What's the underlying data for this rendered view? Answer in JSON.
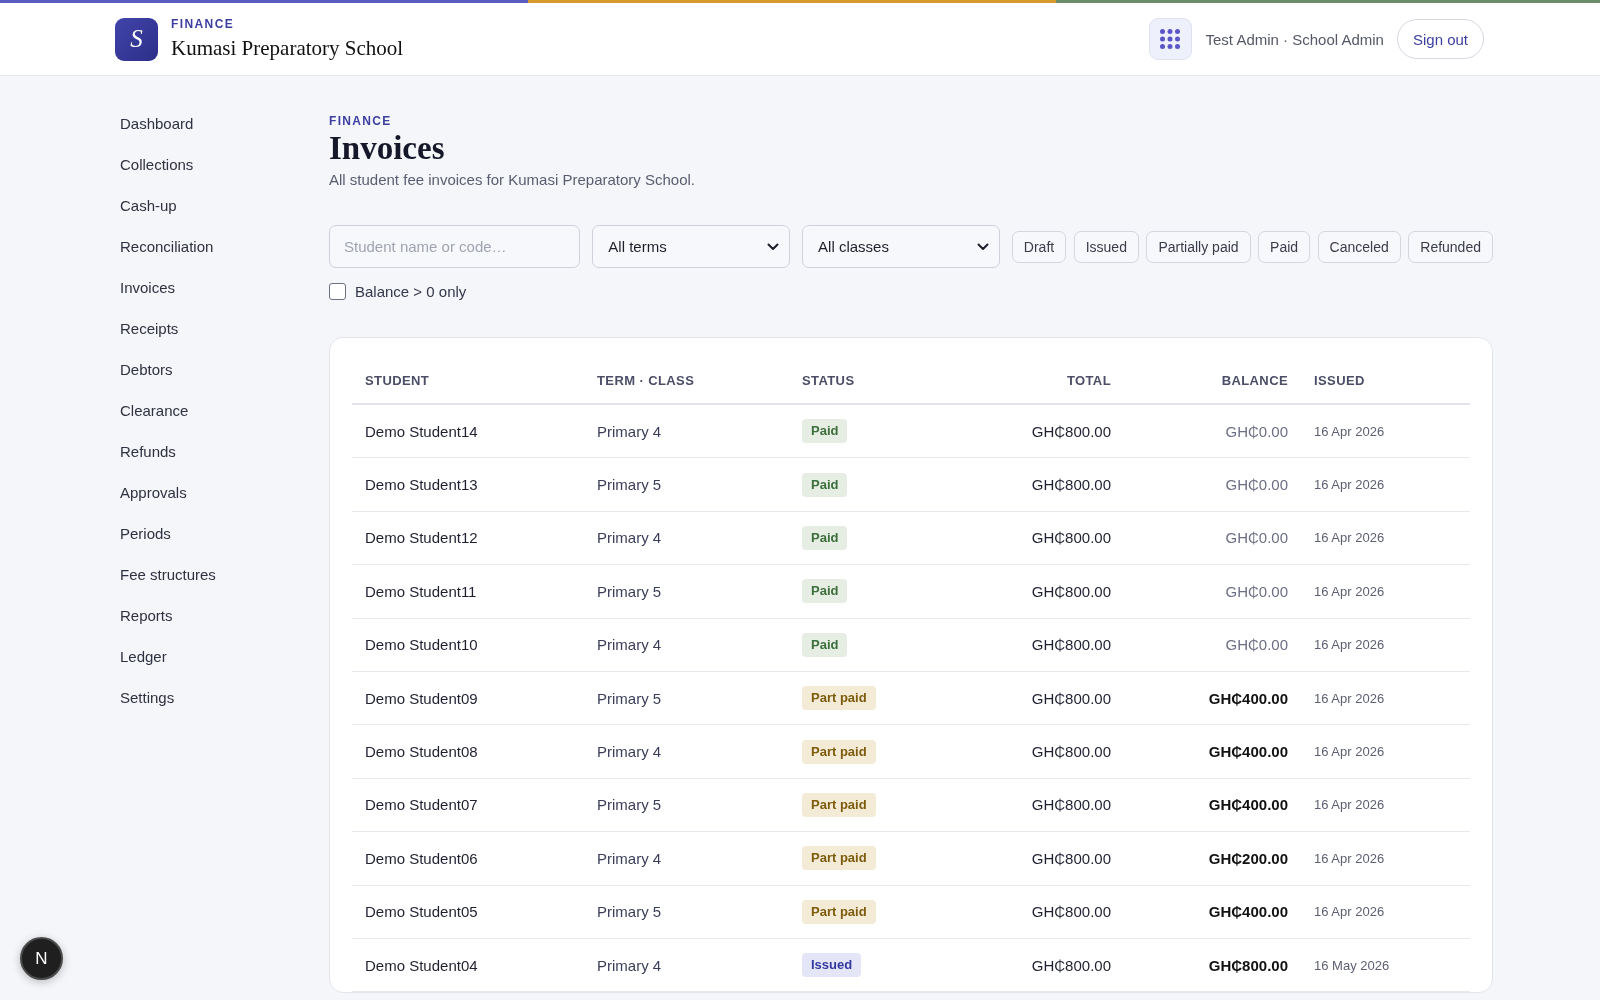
{
  "brand": {
    "logo_letter": "S",
    "section": "FINANCE",
    "school": "Kumasi Preparatory School"
  },
  "account": {
    "user": "Test Admin · School Admin",
    "sign_out": "Sign out"
  },
  "sidebar": {
    "items": [
      "Dashboard",
      "Collections",
      "Cash-up",
      "Reconciliation",
      "Invoices",
      "Receipts",
      "Debtors",
      "Clearance",
      "Refunds",
      "Approvals",
      "Periods",
      "Fee structures",
      "Reports",
      "Ledger",
      "Settings"
    ]
  },
  "page": {
    "eyebrow": "FINANCE",
    "title": "Invoices",
    "subtitle": "All student fee invoices for Kumasi Preparatory School."
  },
  "filters": {
    "search": {
      "placeholder": "Student name or code…"
    },
    "term": {
      "value": "All terms"
    },
    "class": {
      "value": "All classes"
    },
    "statuses": [
      "Draft",
      "Issued",
      "Partially paid",
      "Paid",
      "Canceled",
      "Refunded"
    ],
    "balance_only": {
      "label": "Balance > 0 only",
      "checked": false
    }
  },
  "table": {
    "columns": [
      "STUDENT",
      "TERM · CLASS",
      "STATUS",
      "TOTAL",
      "BALANCE",
      "ISSUED"
    ],
    "rows": [
      {
        "student": "Demo Student14",
        "term_class": "Primary 4",
        "status": {
          "label": "Paid",
          "kind": "paid"
        },
        "total": "GH₵800.00",
        "balance": "GH₵0.00",
        "outstanding": false,
        "issued": "16 Apr 2026"
      },
      {
        "student": "Demo Student13",
        "term_class": "Primary 5",
        "status": {
          "label": "Paid",
          "kind": "paid"
        },
        "total": "GH₵800.00",
        "balance": "GH₵0.00",
        "outstanding": false,
        "issued": "16 Apr 2026"
      },
      {
        "student": "Demo Student12",
        "term_class": "Primary 4",
        "status": {
          "label": "Paid",
          "kind": "paid"
        },
        "total": "GH₵800.00",
        "balance": "GH₵0.00",
        "outstanding": false,
        "issued": "16 Apr 2026"
      },
      {
        "student": "Demo Student11",
        "term_class": "Primary 5",
        "status": {
          "label": "Paid",
          "kind": "paid"
        },
        "total": "GH₵800.00",
        "balance": "GH₵0.00",
        "outstanding": false,
        "issued": "16 Apr 2026"
      },
      {
        "student": "Demo Student10",
        "term_class": "Primary 4",
        "status": {
          "label": "Paid",
          "kind": "paid"
        },
        "total": "GH₵800.00",
        "balance": "GH₵0.00",
        "outstanding": false,
        "issued": "16 Apr 2026"
      },
      {
        "student": "Demo Student09",
        "term_class": "Primary 5",
        "status": {
          "label": "Part paid",
          "kind": "partial"
        },
        "total": "GH₵800.00",
        "balance": "GH₵400.00",
        "outstanding": true,
        "issued": "16 Apr 2026"
      },
      {
        "student": "Demo Student08",
        "term_class": "Primary 4",
        "status": {
          "label": "Part paid",
          "kind": "partial"
        },
        "total": "GH₵800.00",
        "balance": "GH₵400.00",
        "outstanding": true,
        "issued": "16 Apr 2026"
      },
      {
        "student": "Demo Student07",
        "term_class": "Primary 5",
        "status": {
          "label": "Part paid",
          "kind": "partial"
        },
        "total": "GH₵800.00",
        "balance": "GH₵400.00",
        "outstanding": true,
        "issued": "16 Apr 2026"
      },
      {
        "student": "Demo Student06",
        "term_class": "Primary 4",
        "status": {
          "label": "Part paid",
          "kind": "partial"
        },
        "total": "GH₵800.00",
        "balance": "GH₵200.00",
        "outstanding": true,
        "issued": "16 Apr 2026"
      },
      {
        "student": "Demo Student05",
        "term_class": "Primary 5",
        "status": {
          "label": "Part paid",
          "kind": "partial"
        },
        "total": "GH₵800.00",
        "balance": "GH₵400.00",
        "outstanding": true,
        "issued": "16 Apr 2026"
      },
      {
        "student": "Demo Student04",
        "term_class": "Primary 4",
        "status": {
          "label": "Issued",
          "kind": "issued"
        },
        "total": "GH₵800.00",
        "balance": "GH₵800.00",
        "outstanding": true,
        "issued": "16 May 2026"
      }
    ]
  },
  "dev_indicator": {
    "label": "N"
  }
}
